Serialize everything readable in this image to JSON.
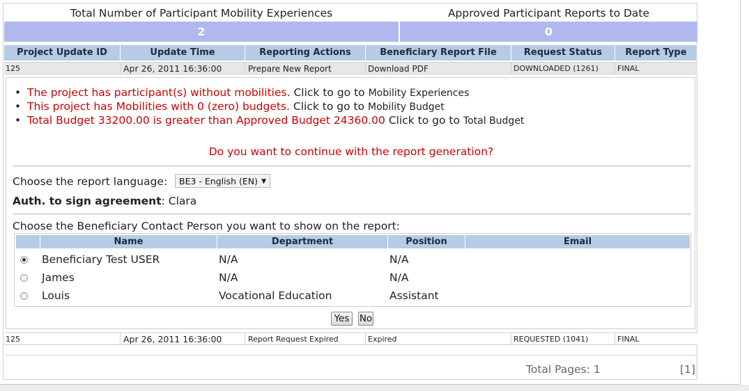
{
  "summary": {
    "participants_label": "Total Number of Participant Mobility Experiences",
    "participants_value": "2",
    "reports_label": "Approved Participant Reports to Date",
    "reports_value": "0"
  },
  "table": {
    "headers": [
      "Project Update ID",
      "Update Time",
      "Reporting Actions",
      "Beneficiary Report File",
      "Request Status",
      "Report Type"
    ],
    "rows": [
      [
        "125",
        "Apr 26, 2011 16:36:00",
        "Prepare New Report",
        "Download PDF",
        "DOWNLOADED (1261)",
        "FINAL"
      ],
      [
        "125",
        "Apr 26, 2011 16:36:00",
        "Report Request Expired",
        "Expired",
        "REQUESTED (1041)",
        "FINAL"
      ]
    ]
  },
  "warnings": [
    {
      "text": "The project has participant(s) without mobilities.",
      "link": "Click to go to",
      "target": "Mobility Experiences"
    },
    {
      "text": "This project has Mobilities with 0 (zero) budgets.",
      "link": "Click to go to",
      "target": "Mobility Budget"
    },
    {
      "text": "Total Budget 33200.00 is greater than Approved Budget 24360.00",
      "link": "Click to go to",
      "target": "Total Budget"
    }
  ],
  "question": "Do you want to continue with the report generation?",
  "language": {
    "label": "Choose the report language:",
    "selected": "BE3 - English (EN)"
  },
  "auth": {
    "label": "Auth. to sign agreement",
    "value": ": Clara"
  },
  "contacts": {
    "label": "Choose the Beneficiary Contact Person you want to show on the report:",
    "headers": [
      "Name",
      "Department",
      "Position",
      "Email"
    ],
    "rows": [
      {
        "name": "Beneficiary Test USER",
        "department": "N/A",
        "position": "N/A",
        "email": "",
        "selected": true
      },
      {
        "name": "James",
        "department": "N/A",
        "position": "N/A",
        "email": "",
        "selected": false
      },
      {
        "name": "Louis",
        "department": "Vocational Education",
        "position": "Assistant",
        "email": "",
        "selected": false
      }
    ]
  },
  "buttons": {
    "yes": "Yes",
    "no": "No"
  },
  "pagination": {
    "total": "Total Pages: 1",
    "index": "[1]"
  },
  "colors": {
    "summary_bar": "#b0b9ee",
    "header_bar": "#b6cbe6",
    "warning": "#cc0000"
  }
}
